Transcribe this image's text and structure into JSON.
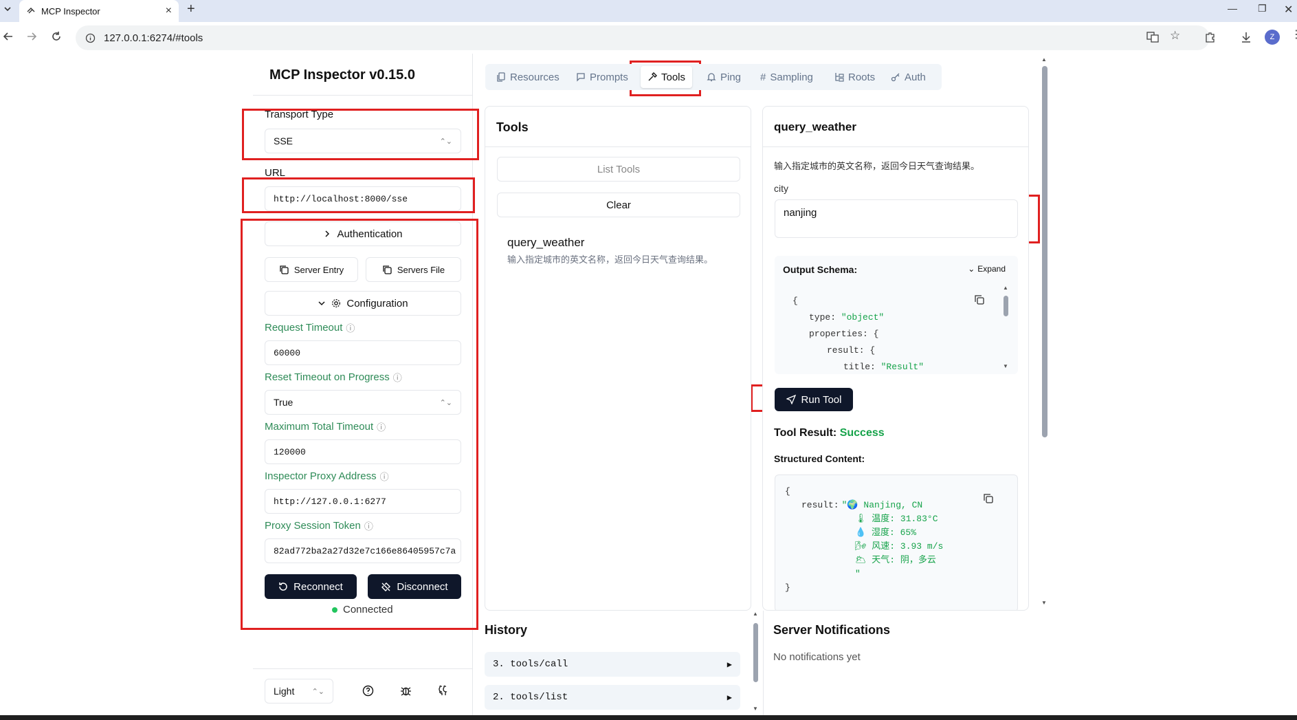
{
  "browser": {
    "tab_title": "MCP Inspector",
    "url": "127.0.0.1:6274/#tools",
    "avatar_letter": "Z"
  },
  "sidebar": {
    "title": "MCP Inspector v0.15.0",
    "transport_label": "Transport Type",
    "transport_value": "SSE",
    "url_label": "URL",
    "url_value": "http://localhost:8000/sse",
    "auth_label": "Authentication",
    "server_entry_label": "Server Entry",
    "servers_file_label": "Servers File",
    "config_label": "Configuration",
    "config": [
      {
        "label": "Request Timeout",
        "value": "60000"
      },
      {
        "label": "Reset Timeout on Progress",
        "value": "True"
      },
      {
        "label": "Maximum Total Timeout",
        "value": "120000"
      },
      {
        "label": "Inspector Proxy Address",
        "value": "http://127.0.0.1:6277"
      },
      {
        "label": "Proxy Session Token",
        "value": "82ad772ba2a27d32e7c166e86405957c7a"
      }
    ],
    "reconnect_label": "Reconnect",
    "disconnect_label": "Disconnect",
    "status": "Connected",
    "theme": "Light"
  },
  "tabs": [
    "Resources",
    "Prompts",
    "Tools",
    "Ping",
    "Sampling",
    "Roots",
    "Auth"
  ],
  "tools_panel": {
    "title": "Tools",
    "list_label": "List Tools",
    "clear_label": "Clear",
    "tool_name": "query_weather",
    "tool_desc": "输入指定城市的英文名称，返回今日天气查询结果。"
  },
  "detail_panel": {
    "title": "query_weather",
    "desc": "输入指定城市的英文名称，返回今日天气查询结果。",
    "param_label": "city",
    "param_value": "nanjing",
    "output_schema_label": "Output Schema:",
    "expand_label": "Expand",
    "schema_lines": {
      "open": "{",
      "type_key": "type:",
      "type_val": "\"object\"",
      "props": "properties: {",
      "result": "result: {",
      "title_key": "title:",
      "title_val": "\"Result\""
    },
    "run_label": "Run Tool",
    "result_label": "Tool Result:",
    "result_status": "Success",
    "structured_label": "Structured Content:",
    "result_lines": {
      "open": "{",
      "key": "result:",
      "l1": "\"🌍 Nanjing, CN",
      "l2": "🌡 温度: 31.83°C",
      "l3": "💧 湿度: 65%",
      "l4": "🌬 风速: 3.93 m/s",
      "l5": "🌥 天气: 阴，多云",
      "l6": "\"",
      "close": "}"
    }
  },
  "history": {
    "title": "History",
    "items": [
      "3. tools/call",
      "2. tools/list"
    ]
  },
  "notifications": {
    "title": "Server Notifications",
    "empty": "No notifications yet"
  },
  "colors": {
    "accent": "#0f172a",
    "success": "#16a34a",
    "label_green": "#2e8b57",
    "annotation_red": "#e02020"
  }
}
